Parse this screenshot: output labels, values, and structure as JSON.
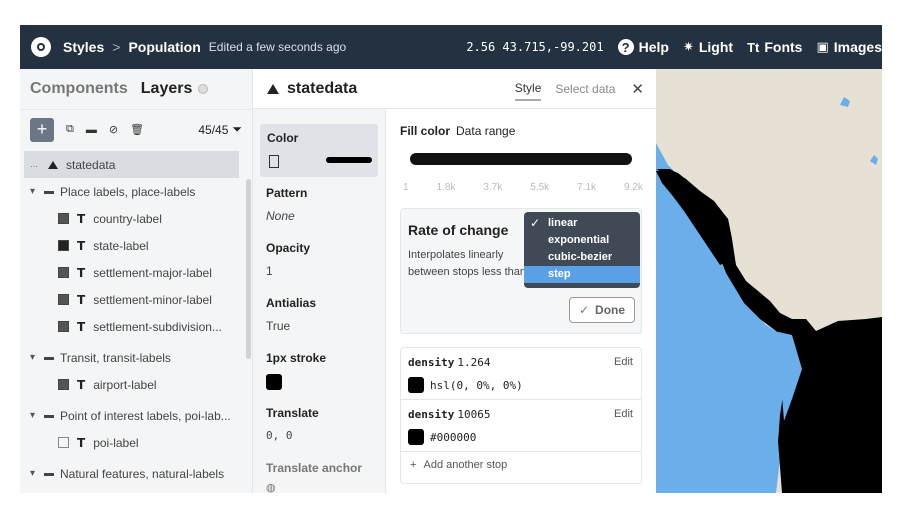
{
  "topbar": {
    "crumb1": "Styles",
    "separator": ">",
    "crumb2": "Population",
    "edited": "Edited a few seconds ago",
    "coords": "2.56 43.715,-99.201",
    "help": "Help",
    "light": "Light",
    "fonts": "Fonts",
    "images": "Images",
    "icons": {
      "help": "question-icon",
      "light": "sun-icon",
      "fonts": "font-icon",
      "images": "image-icon"
    }
  },
  "left": {
    "tab_components": "Components",
    "tab_layers": "Layers",
    "layer_count": "45/45",
    "layers": [
      {
        "label": "statedata",
        "selected": true
      },
      {
        "label": "Place labels, place-labels",
        "group": true
      },
      {
        "label": "country-label"
      },
      {
        "label": "state-label"
      },
      {
        "label": "settlement-major-label"
      },
      {
        "label": "settlement-minor-label"
      },
      {
        "label": "settlement-subdivision..."
      },
      {
        "label": "Transit, transit-labels",
        "group": true
      },
      {
        "label": "airport-label"
      },
      {
        "label": "Point of interest labels, poi-lab...",
        "group": true
      },
      {
        "label": "poi-label"
      },
      {
        "label": "Natural features, natural-labels",
        "group": true
      }
    ]
  },
  "panel": {
    "layer_name": "statedata",
    "tab_style": "Style",
    "tab_select": "Select data",
    "props": {
      "color": "Color",
      "pattern": "Pattern",
      "pattern_value": "None",
      "opacity": "Opacity",
      "opacity_value": "1",
      "antialias": "Antialias",
      "antialias_value": "True",
      "stroke": "1px stroke",
      "translate": "Translate",
      "translate_value": "0, 0",
      "translate_anchor": "Translate anchor"
    },
    "fill": {
      "label": "Fill color",
      "mode": "Data range",
      "ticks": [
        "1",
        "1.8k",
        "3.7k",
        "5.5k",
        "7.1k",
        "9.2k"
      ],
      "rate_title": "Rate of change",
      "rate_desc": "Interpolates linearly between stops less than and just greater than",
      "done": "Done",
      "options": [
        "linear",
        "exponential",
        "cubic-bezier",
        "step"
      ],
      "selected_option": "linear",
      "highlighted_option": "step",
      "stops": [
        {
          "key": "density",
          "value": "1.264",
          "color": "hsl(0, 0%, 0%)",
          "edit": "Edit"
        },
        {
          "key": "density",
          "value": "10065",
          "color": "#000000",
          "edit": "Edit"
        }
      ],
      "add_stop": "Add another stop"
    }
  },
  "colors": {
    "topbar": "#233140",
    "ocean": "#6aaeea",
    "land": "#e6e0d5",
    "highlight": "#5aa0e6"
  }
}
